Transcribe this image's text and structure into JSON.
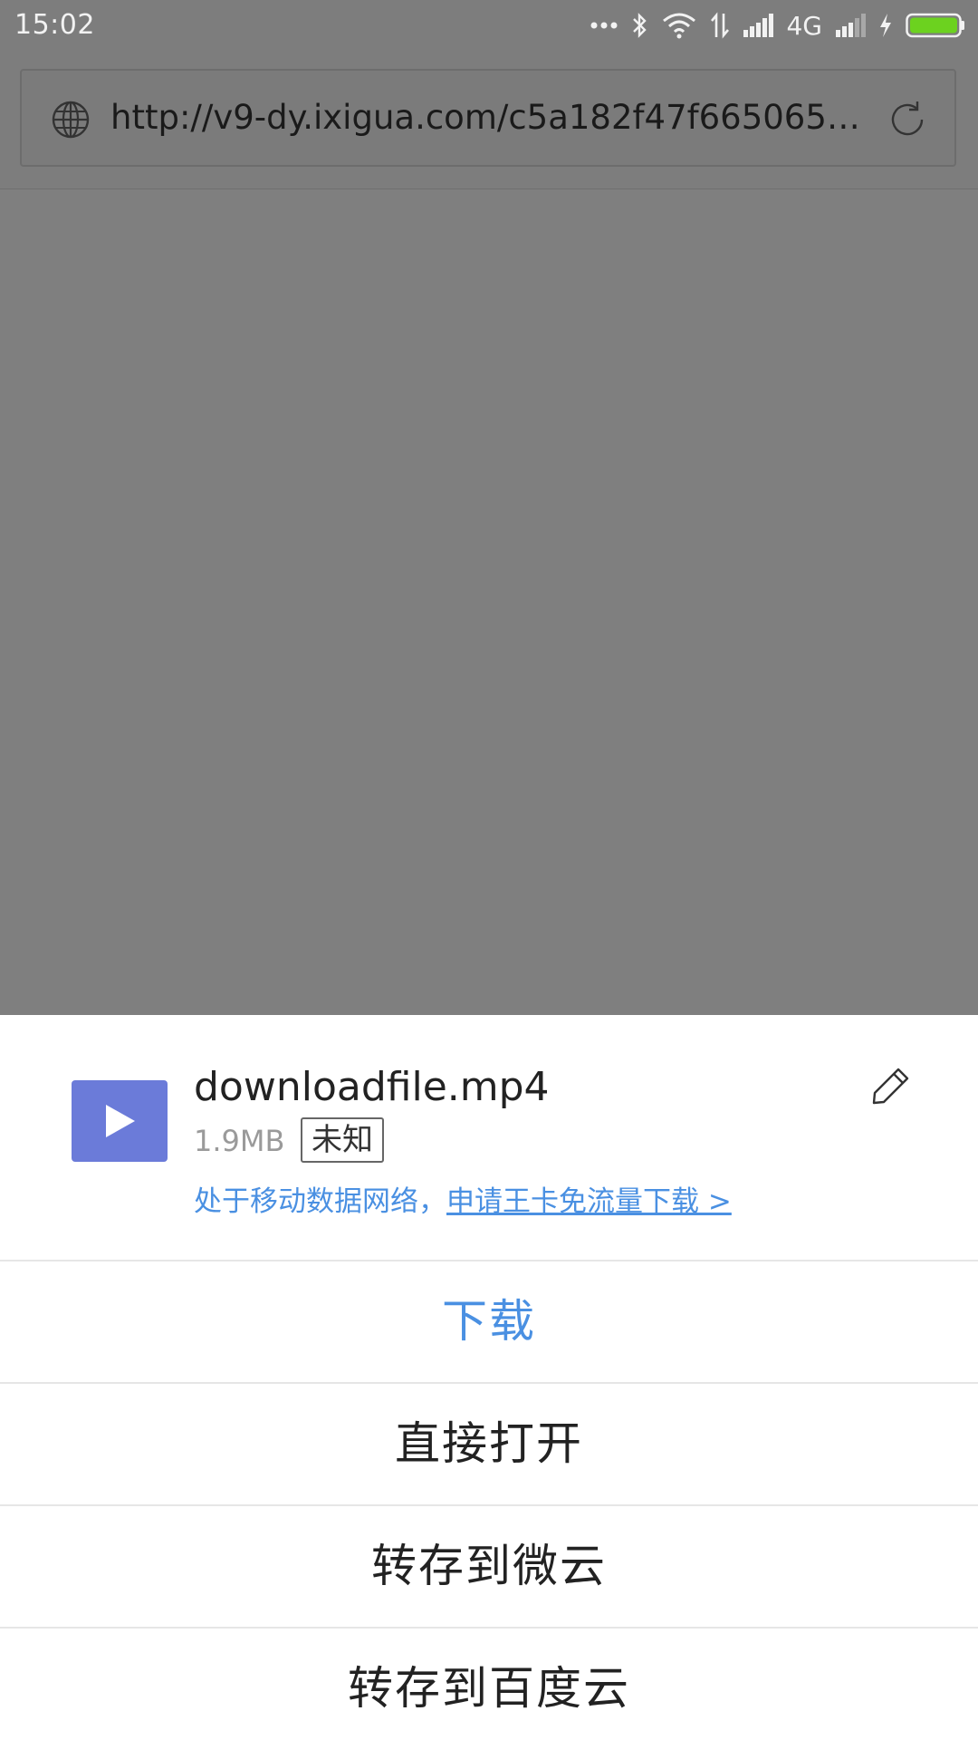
{
  "status_bar": {
    "time": "15:02",
    "network_type": "4G",
    "icons": [
      "more-dots-icon",
      "bluetooth-icon",
      "wifi-icon",
      "data-transfer-icon",
      "signal-icon",
      "signal-weak-icon",
      "charging-icon",
      "battery-icon"
    ],
    "battery_color": "#6cd21f"
  },
  "browser": {
    "url": "http://v9-dy.ixigua.com/c5a182f47f66506563cf...",
    "icons": [
      "globe-icon",
      "refresh-icon"
    ]
  },
  "download_sheet": {
    "file_name": "downloadfile.mp4",
    "file_size": "1.9MB",
    "file_type_badge": "未知",
    "network_note_prefix": "处于移动数据网络，",
    "network_note_link": "申请王卡免流量下载 >",
    "accent_color": "#4a90e2",
    "file_icon_color": "#6b7bd9",
    "actions": [
      {
        "label": "下载"
      },
      {
        "label": "直接打开"
      },
      {
        "label": "转存到微云"
      },
      {
        "label": "转存到百度云"
      }
    ]
  }
}
